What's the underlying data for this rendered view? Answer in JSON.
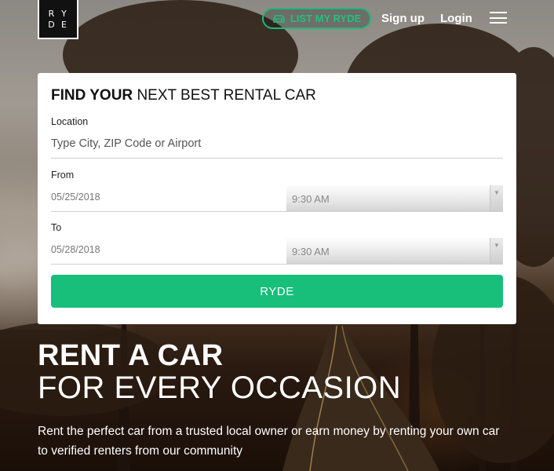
{
  "header": {
    "logo_letters": [
      "R",
      "Y",
      "D",
      "E"
    ],
    "list_button_label": "LIST MY RYDE",
    "list_button_icon": "car-icon",
    "signup_label": "Sign up",
    "login_label": "Login",
    "menu_icon": "hamburger-menu-icon"
  },
  "search": {
    "title_bold": "FIND YOUR",
    "title_rest": " NEXT BEST RENTAL CAR",
    "location_label": "Location",
    "location_placeholder": "Type City, ZIP Code or Airport",
    "from_label": "From",
    "from_date": "05/25/2018",
    "from_time": "9:30 AM",
    "to_label": "To",
    "to_date": "05/28/2018",
    "to_time": "9:30 AM",
    "submit_label": "RYDE"
  },
  "hero": {
    "title": "RENT A CAR",
    "subtitle": "FOR EVERY OCCASION",
    "description": "Rent the perfect car from a trusted local owner or earn money by renting your own car to verified renters from our community"
  },
  "colors": {
    "accent": "#17bf7a",
    "text_light": "#ffffff"
  }
}
